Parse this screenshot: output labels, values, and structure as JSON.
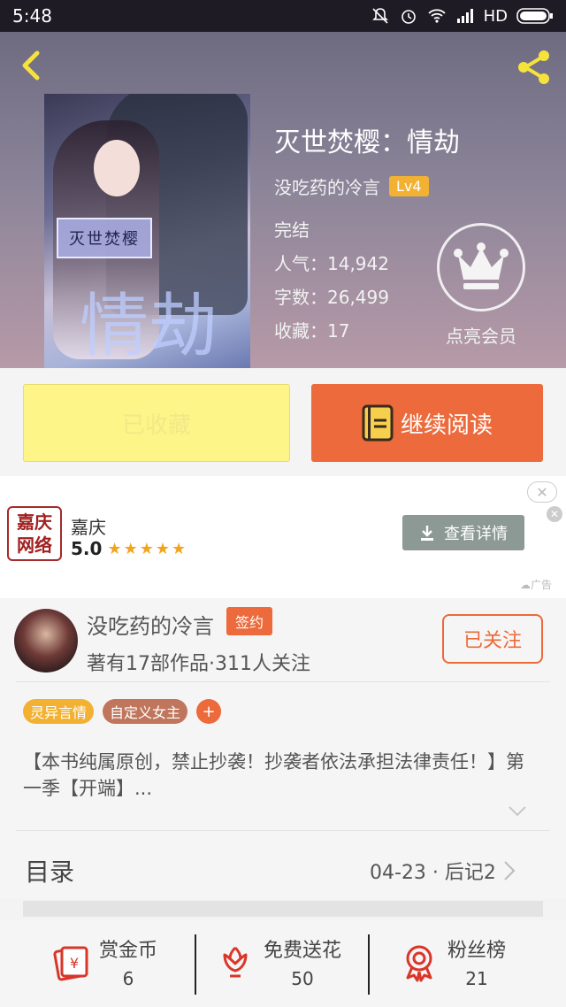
{
  "status_bar": {
    "time": "5:48",
    "network": "HD"
  },
  "book": {
    "title": "灭世焚樱：情劫",
    "author": "没吃药的冷言",
    "level": "Lv4",
    "status": "完结",
    "popularity": "人气：14,942",
    "word_count": "字数：26,499",
    "favorites": "收藏：17",
    "vip_label": "点亮会员",
    "cover_plate_text": "灭世焚樱",
    "cover_calligraphy": "情劫"
  },
  "actions": {
    "collected_label": "已收藏",
    "continue_label": "继续阅读"
  },
  "ad": {
    "logo_line1": "嘉庆",
    "logo_line2": "网络",
    "name": "嘉庆",
    "score": "5.0",
    "stars": "★★★★★",
    "button_label": "查看详情",
    "close_label": "✕",
    "tag": "广告"
  },
  "author_panel": {
    "name": "没吃药的冷言",
    "badge": "签约",
    "stats": "著有17部作品·311人关注",
    "follow_label": "已关注",
    "tags": [
      "灵异言情",
      "自定义女主"
    ],
    "description": "【本书纯属原创，禁止抄袭！抄袭者依法承担法律责任！】第一季【开端】...",
    "toc_label": "目录",
    "toc_latest": "04-23 · 后记2"
  },
  "bottom_stats": [
    {
      "label": "赏金币",
      "value": "6",
      "icon": "coin-envelope-icon"
    },
    {
      "label": "免费送花",
      "value": "50",
      "icon": "flower-icon"
    },
    {
      "label": "粉丝榜",
      "value": "21",
      "icon": "medal-icon"
    }
  ],
  "colors": {
    "accent": "#ec6a3b",
    "collected_bg": "#fdf587",
    "level_badge": "#f2b133",
    "tag_secondary": "#c0765c"
  }
}
